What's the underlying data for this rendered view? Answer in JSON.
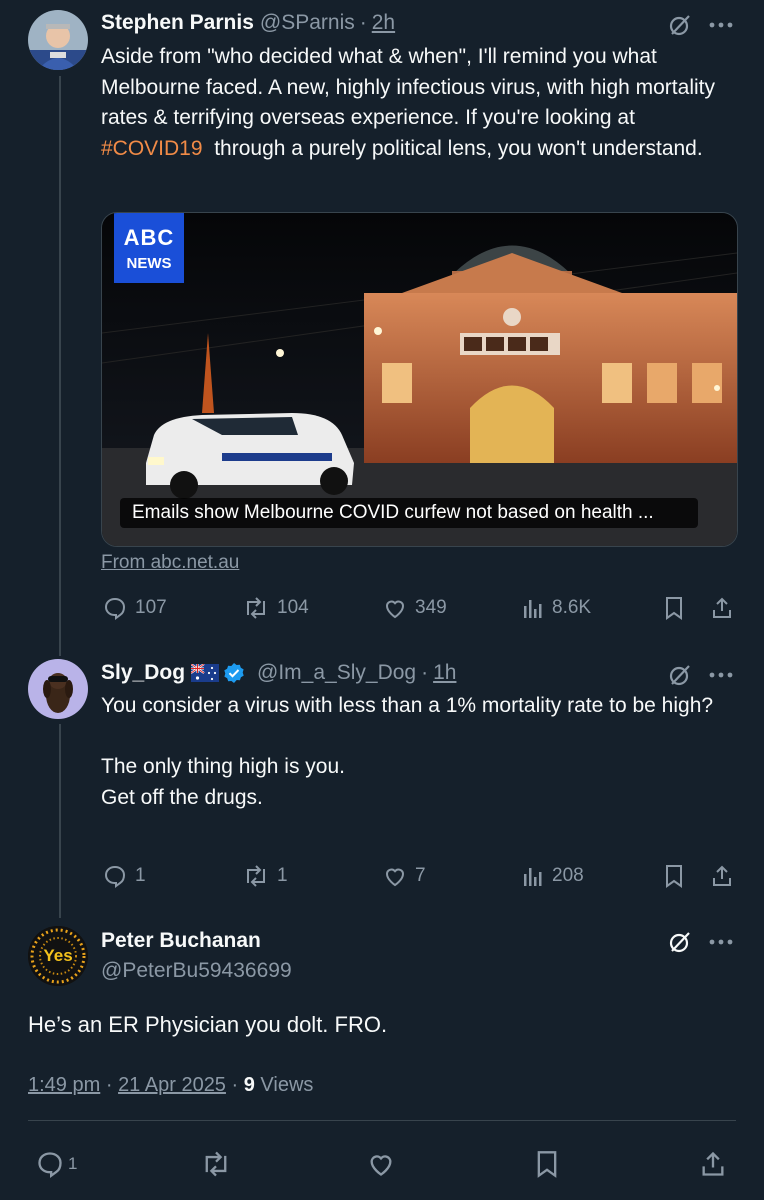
{
  "tweet1": {
    "name": "Stephen Parnis",
    "handle": "@SParnis",
    "sep": "·",
    "time": "2h",
    "text_before": "Aside from \"who decided what & when\", I'll remind you what Melbourne faced. A new, highly infectious virus, with high mortality rates & terrifying overseas experience. If you're looking at ",
    "hashtag": "#COVID19",
    "text_after": "  through a purely political lens, you won't understand.",
    "card": {
      "logo_top": "ABC",
      "logo_bottom": "NEWS",
      "caption": "Emails show Melbourne COVID curfew not based on health ...",
      "source": "From abc.net.au"
    },
    "stats": {
      "replies": "107",
      "reposts": "104",
      "likes": "349",
      "views": "8.6K"
    }
  },
  "tweet2": {
    "name": "Sly_Dog",
    "handle": "@Im_a_Sly_Dog",
    "sep": "·",
    "time": "1h",
    "line1": "You consider a virus with less than a 1% mortality rate to be high?",
    "line2": "The only thing high is you.",
    "line3": "Get off the drugs.",
    "stats": {
      "replies": "1",
      "reposts": "1",
      "likes": "7",
      "views": "208"
    }
  },
  "tweet3": {
    "name": "Peter Buchanan",
    "handle": "@PeterBu59436699",
    "avatar_text": "Yes",
    "text": "He’s an ER Physician you dolt. FRO.",
    "time": "1:49 pm",
    "sep": "·",
    "date": "21 Apr 2025",
    "views_count": "9",
    "views_label": "Views",
    "stats": {
      "replies": "1"
    }
  },
  "colors": {
    "background": "#15202b",
    "muted": "#8b98a5",
    "hashtag": "#f18b47",
    "verified": "#1d9bf0"
  }
}
